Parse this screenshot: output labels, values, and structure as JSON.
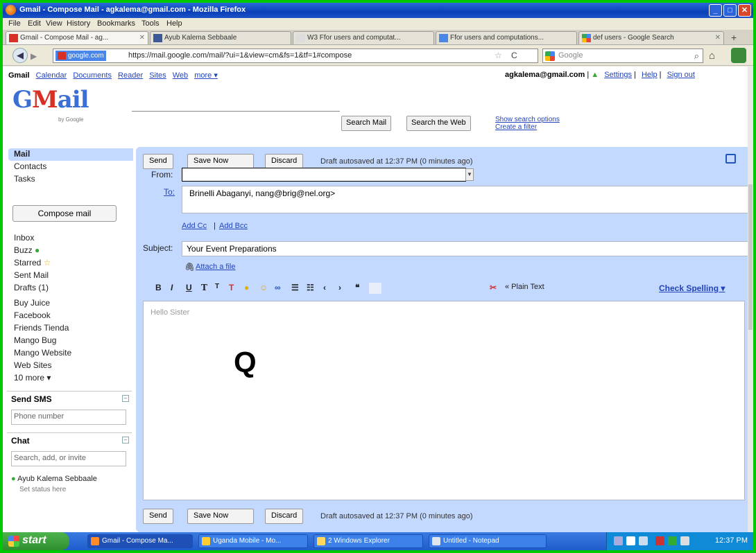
{
  "window": {
    "title": "Gmail - Compose Mail - agkalema@gmail.com - Mozilla Firefox"
  },
  "menu": [
    "File",
    "Edit",
    "View",
    "History",
    "Bookmarks",
    "Tools",
    "Help"
  ],
  "tabs": [
    {
      "label": "Gmail - Compose Mail - ag...",
      "icon": "gmail-icon"
    },
    {
      "label": "Ayub Kalema Sebbaale",
      "icon": "facebook-icon"
    },
    {
      "label": "W3 Ffor users and computat...",
      "icon": "page-icon"
    },
    {
      "label": "Ffor users and computations...",
      "icon": "page-icon"
    },
    {
      "label": "def users - Google Search",
      "icon": "google-icon"
    }
  ],
  "nav": {
    "site_badge": "google.com",
    "url": "https://mail.google.com/mail/?ui=1&view=cm&fs=1&tf=1#compose",
    "search_placeholder": "Google"
  },
  "gmail": {
    "topnav": {
      "brand": "Gmail",
      "links": [
        "Calendar",
        "Documents",
        "Reader",
        "Sites",
        "Web",
        "more ▾"
      ]
    },
    "account": {
      "email": "agkalema@gmail.com",
      "links": [
        "Settings",
        "Help",
        "Sign out"
      ]
    },
    "logo": {
      "text_a": "G",
      "text_m": "M",
      "text_b": "ail",
      "tagline": "by Google"
    },
    "search_mail": "Search Mail",
    "search_web": "Search the Web",
    "search_links": [
      "Show search options",
      "Create a filter"
    ],
    "left_nav": {
      "top": [
        "Mail",
        "Contacts",
        "Tasks"
      ],
      "compose": "Compose mail",
      "folders": [
        "Inbox",
        "Buzz",
        "Starred",
        "Sent Mail",
        "Drafts (1)"
      ],
      "labels": [
        "Buy Juice",
        "Facebook",
        "Friends Tienda",
        "Mango Bug",
        "Mango Website",
        "Web Sites",
        "10 more ▾"
      ],
      "send_sms": "Send SMS",
      "phone_placeholder": "Phone number",
      "chat": "Chat",
      "chat_search": "Search, add, or invite",
      "chat_user": "Ayub Kalema Sebbaale",
      "chat_status": "Set status here"
    },
    "compose": {
      "send": "Send",
      "save_now": "Save Now",
      "discard": "Discard",
      "draft_status": "Draft autosaved at 12:37 PM (0 minutes ago)",
      "from_label": "From:",
      "to_label": "To:",
      "to_value": "Brinelli Abaganyi, nang@brig@nel.org>",
      "add_cc": "Add Cc",
      "add_bcc": "Add Bcc",
      "subject_label": "Subject:",
      "subject_value": "Your Event Preparations",
      "attach": "Attach a file",
      "plain_text": "« Plain Text",
      "check_spelling": "Check Spelling ▾",
      "body_start": "Hello Sister",
      "body_mark": "Q",
      "bottom_draft": "Draft autosaved at 12:37 PM (0 minutes ago)"
    }
  },
  "taskbar": {
    "start": "start",
    "tasks": [
      "Gmail - Compose Ma...",
      "Uganda Mobile - Mo...",
      "2 Windows Explorer",
      "Untitled - Notepad"
    ],
    "clock": "12:37 PM"
  }
}
